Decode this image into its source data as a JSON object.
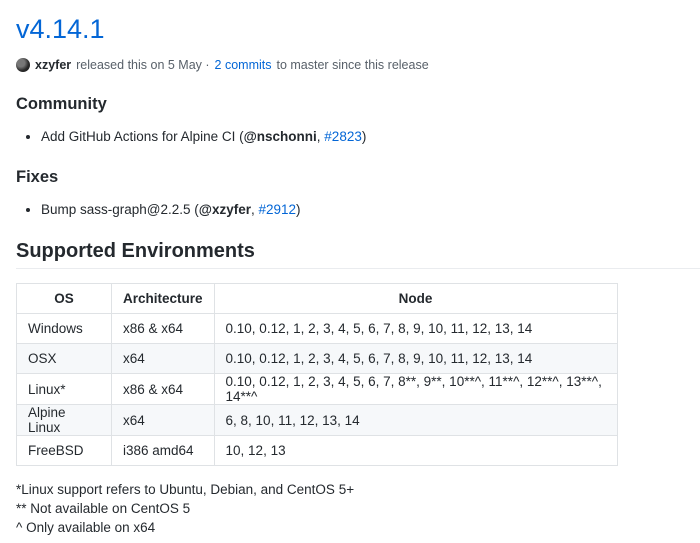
{
  "release": {
    "title": "v4.14.1",
    "author": "xzyfer",
    "released_text": "released this on 5 May ·",
    "commits_link": "2 commits",
    "commits_suffix": "to master since this release"
  },
  "sections": {
    "community": {
      "heading": "Community",
      "item": {
        "text": "Add GitHub Actions for Alpine CI (",
        "user": "@nschonni",
        "sep": ", ",
        "pr": "#2823",
        "end": ")"
      }
    },
    "fixes": {
      "heading": "Fixes",
      "item": {
        "text": "Bump sass-graph@2.2.5 (",
        "user": "@xzyfer",
        "sep": ", ",
        "pr": "#2912",
        "end": ")"
      }
    },
    "supported": {
      "heading": "Supported Environments",
      "headers": [
        "OS",
        "Architecture",
        "Node"
      ],
      "rows": [
        [
          "Windows",
          "x86 & x64",
          "0.10, 0.12, 1, 2, 3, 4, 5, 6, 7, 8, 9, 10, 11, 12, 13, 14"
        ],
        [
          "OSX",
          "x64",
          "0.10, 0.12, 1, 2, 3, 4, 5, 6, 7, 8, 9, 10, 11, 12, 13, 14"
        ],
        [
          "Linux*",
          "x86 & x64",
          "0.10, 0.12, 1, 2, 3, 4, 5, 6, 7, 8**, 9**, 10**^, 11**^, 12**^, 13**^, 14**^"
        ],
        [
          "Alpine Linux",
          "x64",
          "6, 8, 10, 11, 12, 13, 14"
        ],
        [
          "FreeBSD",
          "i386 amd64",
          "10, 12, 13"
        ]
      ],
      "footnotes": [
        "*Linux support refers to Ubuntu, Debian, and CentOS 5+",
        "** Not available on CentOS 5",
        "^ Only available on x64"
      ]
    }
  }
}
